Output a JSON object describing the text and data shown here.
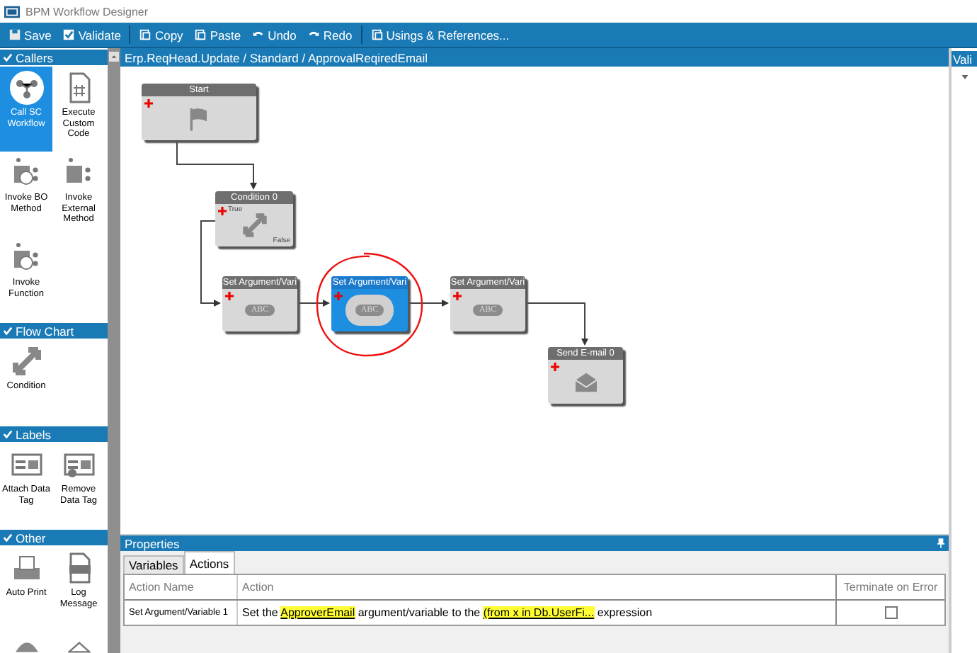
{
  "window": {
    "title": "BPM Workflow Designer"
  },
  "toolbar": [
    [
      {
        "label": "Save",
        "kind": "save"
      },
      {
        "label": "Validate",
        "kind": "validate"
      }
    ],
    [
      {
        "label": "Copy",
        "kind": "copy"
      },
      {
        "label": "Paste",
        "kind": "paste"
      },
      {
        "label": "Undo",
        "kind": "undo"
      },
      {
        "label": "Redo",
        "kind": "redo"
      }
    ],
    [
      {
        "label": "Usings & References...",
        "kind": "usings"
      }
    ]
  ],
  "toolbox": {
    "sections": [
      {
        "title": "Callers",
        "expanded": true,
        "items": [
          {
            "label": "Call SC Workflow",
            "kind": "workflow",
            "selected": true
          },
          {
            "label": "Execute Custom Code",
            "kind": "code",
            "selected": false
          },
          {
            "label": "Invoke BO Method",
            "kind": "bo",
            "selected": false
          },
          {
            "label": "Invoke External Method",
            "kind": "external",
            "selected": false
          },
          {
            "label": "Invoke Function",
            "kind": "function",
            "selected": false
          }
        ]
      },
      {
        "title": "Flow Chart",
        "expanded": true,
        "items": [
          {
            "label": "Condition",
            "kind": "condition",
            "selected": false
          }
        ]
      },
      {
        "title": "Labels",
        "expanded": true,
        "items": [
          {
            "label": "Attach Data Tag",
            "kind": "attach",
            "selected": false
          },
          {
            "label": "Remove Data Tag",
            "kind": "remove",
            "selected": false
          }
        ]
      },
      {
        "title": "Other",
        "expanded": true,
        "items": [
          {
            "label": "Auto Print",
            "kind": "print",
            "selected": false
          },
          {
            "label": "Log Message",
            "kind": "log",
            "selected": false
          },
          {
            "kind": "dome",
            "selected": false
          },
          {
            "kind": "roof",
            "selected": false
          }
        ]
      }
    ]
  },
  "breadcrumb": "Erp.ReqHead.Update / Standard / ApprovalReqiredEmail",
  "canvas": {
    "nodes": [
      {
        "title": "Start",
        "kind": "start",
        "selected": false
      },
      {
        "title": "Condition 0",
        "kind": "condition",
        "selected": false,
        "true_label": "True",
        "false_label": "False"
      },
      {
        "title": "Set Argument/Vari",
        "kind": "set",
        "selected": false,
        "badge": "ABC"
      },
      {
        "title": "Set Argument/Vari",
        "kind": "set",
        "selected": true,
        "badge": "ABC"
      },
      {
        "title": "Set Argument/Vari",
        "kind": "set",
        "selected": false,
        "badge": "ABC"
      },
      {
        "title": "Send E-mail 0",
        "kind": "email",
        "selected": false
      }
    ]
  },
  "properties": {
    "title": "Properties",
    "tabs": [
      {
        "label": "Variables",
        "selected": false
      },
      {
        "label": "Actions",
        "selected": true
      }
    ],
    "table": {
      "columns": [
        "Action Name",
        "Action",
        "Terminate on Error"
      ],
      "rows": [
        {
          "action_name": "Set Argument/Variable 1",
          "action": [
            {
              "kind": "text",
              "text": "Set the"
            },
            {
              "kind": "link",
              "text": "ApproverEmail"
            },
            {
              "kind": "text",
              "text": "argument/variable to the"
            },
            {
              "kind": "link",
              "text": "(from x in Db.UserFi..."
            },
            {
              "kind": "text",
              "text": "expression"
            }
          ],
          "terminate_on_error": false
        }
      ]
    }
  },
  "right_panel": {
    "title": "Vali"
  }
}
